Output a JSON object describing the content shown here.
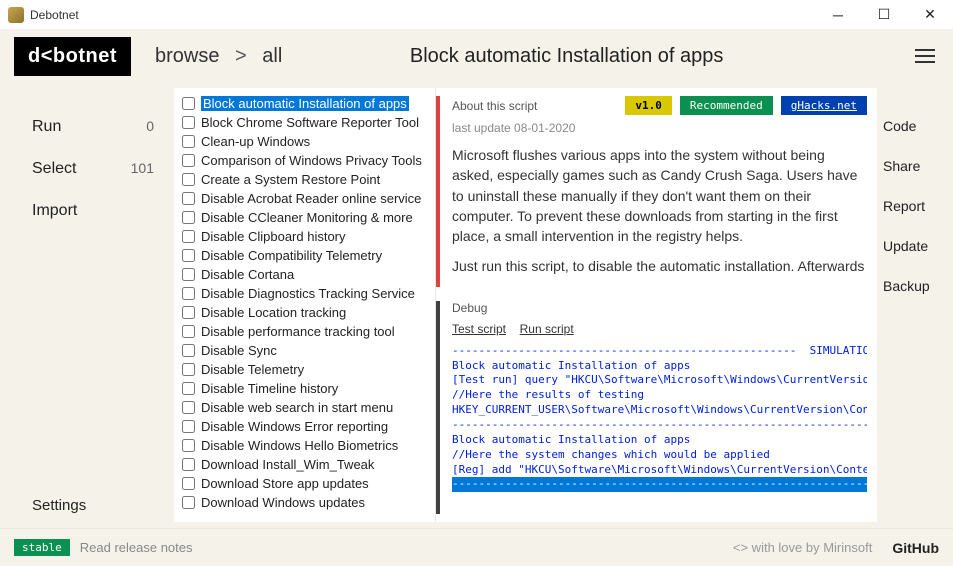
{
  "window": {
    "title": "Debotnet"
  },
  "logo_text": "d<botnet",
  "breadcrumb": {
    "root": "browse",
    "sep": ">",
    "current": "all"
  },
  "header_title": "Block automatic Installation of apps",
  "left_nav": {
    "items": [
      {
        "label": "Run",
        "count": "0"
      },
      {
        "label": "Select",
        "count": "101"
      },
      {
        "label": "Import",
        "count": ""
      }
    ],
    "settings": "Settings"
  },
  "scripts": [
    "Block automatic Installation of apps",
    "Block Chrome Software Reporter Tool",
    "Clean-up Windows",
    "Comparison of Windows Privacy Tools",
    "Create a System Restore Point",
    "Disable Acrobat Reader online service",
    "Disable CCleaner Monitoring & more",
    "Disable Clipboard history",
    "Disable Compatibility Telemetry",
    "Disable Cortana",
    "Disable Diagnostics Tracking Service",
    "Disable Location tracking",
    "Disable performance tracking tool",
    "Disable Sync",
    "Disable Telemetry",
    "Disable Timeline history",
    "Disable web search in start menu",
    "Disable Windows Error reporting",
    "Disable Windows Hello Biometrics",
    "Download Install_Wim_Tweak",
    "Download Store app updates",
    "Download Windows updates"
  ],
  "selected_script_index": 0,
  "detail": {
    "about_label": "About this script",
    "version": "v1.0",
    "recommended": "Recommended",
    "ghacks": "gHacks.net",
    "last_update": "last update 08-01-2020",
    "description1": "Microsoft flushes various apps into the system without being asked, especially games such as Candy Crush Saga. Users have to uninstall these manually if they don't want them on their computer. To prevent these downloads from starting in the first place, a small intervention in the registry helps.",
    "description2": "Just run this script, to disable the automatic installation. Afterwards"
  },
  "debug": {
    "label": "Debug",
    "test_link": "Test script",
    "run_link": "Run script",
    "lines": [
      "----------------------------------------------------  SIMULATION",
      "Block automatic Installation of apps",
      "[Test run] query \"HKCU\\Software\\Microsoft\\Windows\\CurrentVersio",
      "//Here the results of testing",
      "",
      "HKEY_CURRENT_USER\\Software\\Microsoft\\Windows\\CurrentVersion\\Cont",
      "",
      "----------------------------------------------------------------",
      "Block automatic Installation of apps",
      "//Here the system changes which would be applied",
      "[Reg] add \"HKCU\\Software\\Microsoft\\Windows\\CurrentVersion\\Conten"
    ],
    "highlighted": "----------------------------------------------------------------"
  },
  "right_nav": {
    "items": [
      "Code",
      "Share",
      "Report",
      "Update",
      "Backup"
    ]
  },
  "footer": {
    "stable": "stable",
    "release_notes": "Read release notes",
    "love": "<>  with love by Mirinsoft",
    "github": "GitHub"
  }
}
